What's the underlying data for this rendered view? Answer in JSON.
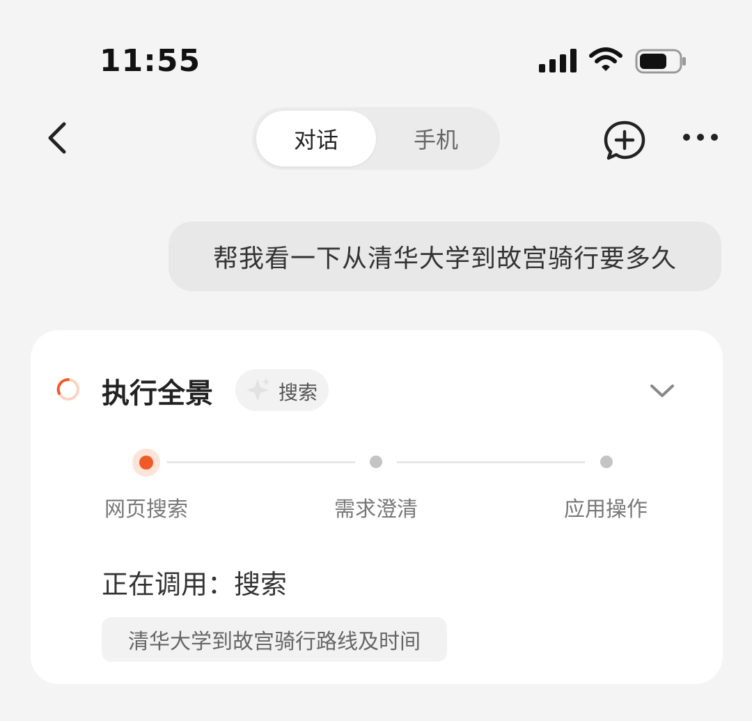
{
  "status_bar": {
    "time": "11:55"
  },
  "nav": {
    "tabs": [
      {
        "label": "对话",
        "active": true
      },
      {
        "label": "手机",
        "active": false
      }
    ],
    "icons": [
      "back-icon",
      "new-chat-icon",
      "more-icon"
    ]
  },
  "message": {
    "text": "帮我看一下从清华大学到故宫骑行要多久"
  },
  "card": {
    "title": "执行全景",
    "chip_label": "搜索",
    "steps": [
      {
        "label": "网页搜索",
        "state": "active"
      },
      {
        "label": "需求澄清",
        "state": "pending"
      },
      {
        "label": "应用操作",
        "state": "pending"
      }
    ],
    "calling_label": "正在调用：",
    "calling_tool": "搜索",
    "query": "清华大学到故宫骑行路线及时间"
  },
  "colors": {
    "accent": "#f05a28",
    "background": "#f4f4f4",
    "card": "#ffffff"
  }
}
